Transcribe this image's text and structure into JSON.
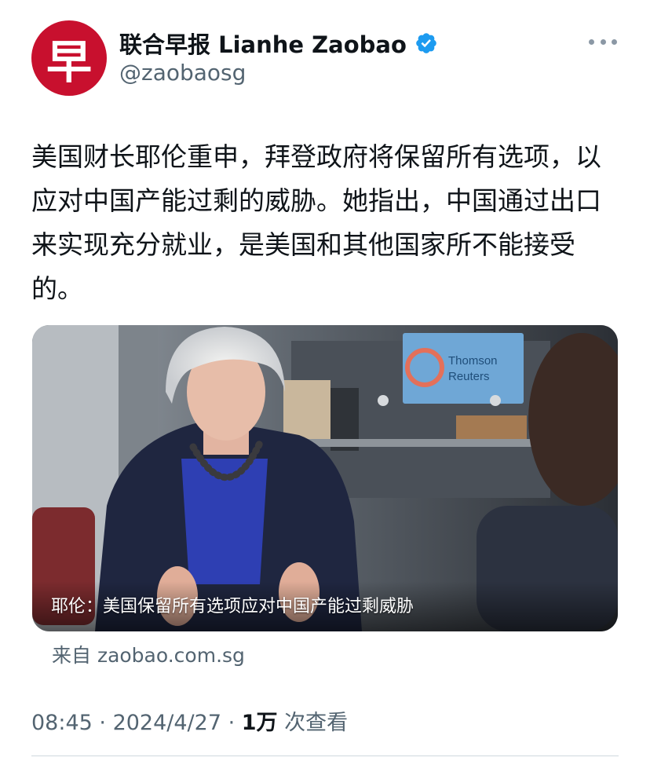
{
  "account": {
    "avatar_glyph": "早",
    "avatar_color": "#c8102e",
    "display_name": "联合早报 Lianhe Zaobao",
    "handle": "@zaobaosg",
    "verified_badge_icon": "verified-badge-icon",
    "verified_color": "#1d9bf0"
  },
  "tweet": {
    "text": "美国财长耶伦重申，拜登政府将保留所有选项，以应对中国产能过剩的威胁。她指出，中国通过出口来实现充分就业，是美国和其他国家所不能接受的。"
  },
  "media": {
    "caption": "耶伦：美国保留所有选项应对中国产能过剩威胁",
    "source": "来自 zaobao.com.sg",
    "screen_text_line1": "Thomson",
    "screen_text_line2": "Reuters"
  },
  "meta": {
    "time": "08:45",
    "separator": " · ",
    "date": "2024/4/27",
    "views_count": "1万",
    "views_label": " 次查看"
  },
  "menu": {
    "more_icon": "more-icon"
  }
}
